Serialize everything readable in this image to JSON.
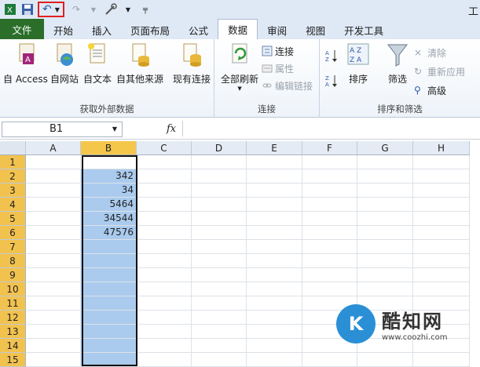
{
  "qat": {
    "title_fragment": "工"
  },
  "tabs": [
    {
      "label": "文件",
      "type": "file"
    },
    {
      "label": "开始"
    },
    {
      "label": "插入"
    },
    {
      "label": "页面布局"
    },
    {
      "label": "公式"
    },
    {
      "label": "数据",
      "active": true
    },
    {
      "label": "审阅"
    },
    {
      "label": "视图"
    },
    {
      "label": "开发工具"
    }
  ],
  "ribbon": {
    "get_external": {
      "label": "获取外部数据",
      "buttons": [
        "自 Access",
        "自网站",
        "自文本",
        "自其他来源",
        "现有连接"
      ]
    },
    "connections": {
      "label": "连接",
      "refresh_all": "全部刷新",
      "connect": "连接",
      "properties": "属性",
      "edit_links": "编辑链接"
    },
    "sort_filter": {
      "label": "排序和筛选",
      "sort": "排序",
      "filter": "筛选",
      "clear": "清除",
      "reapply": "重新应用",
      "advanced": "高级"
    }
  },
  "formula_bar": {
    "name_box": "B1",
    "fx": "fx",
    "value": ""
  },
  "grid": {
    "columns": [
      "A",
      "B",
      "C",
      "D",
      "E",
      "F",
      "G",
      "H"
    ],
    "rows": [
      "1",
      "2",
      "3",
      "4",
      "5",
      "6",
      "7",
      "8",
      "9",
      "10",
      "11",
      "12",
      "13",
      "14",
      "15"
    ],
    "selected_column": "B",
    "values_b": [
      "",
      "342",
      "34",
      "5464",
      "34544",
      "47576",
      "",
      "",
      "",
      "",
      "",
      "",
      "",
      "",
      ""
    ]
  },
  "watermark": {
    "title": "酷知网",
    "url": "www.coozhi.com"
  },
  "colors": {
    "file_tab": "#2a6e2a",
    "selected_header": "#f4c64a",
    "selected_cells": "#aacbee",
    "highlight_box": "#e02020"
  }
}
